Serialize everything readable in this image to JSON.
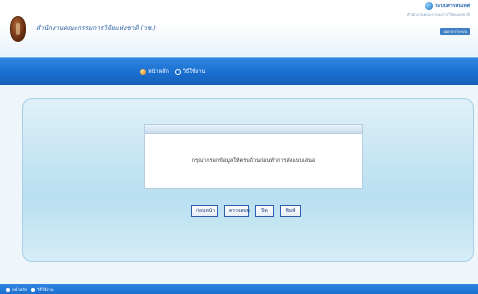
{
  "header": {
    "site_title": "สำนักงานคณะกรรมการวิจัยแห่งชาติ (วช.)",
    "brand_name": "ระบบสารสนเทศ",
    "brand_subtitle": "สำนักงานคณะกรรมการวิจัยแห่งชาติ",
    "user_link": "ออกจากระบบ"
  },
  "nav": {
    "items": [
      {
        "label": "หน้าหลัก",
        "icon": "home-icon"
      },
      {
        "label": "วิธีใช้งาน",
        "icon": "help-icon"
      }
    ]
  },
  "dialog": {
    "message": "กรุณากรอกข้อมูลให้ครบถ้วนก่อนทำการส่งแบบเสนอ"
  },
  "buttons": {
    "back": "ก่อนหน้า",
    "check": "ตรวจสอบ",
    "close": "ปิด",
    "print": "พิมพ์"
  },
  "footer": {
    "items": [
      {
        "label": "หน้าหลัก"
      },
      {
        "label": "วิธีใช้งาน"
      }
    ]
  }
}
